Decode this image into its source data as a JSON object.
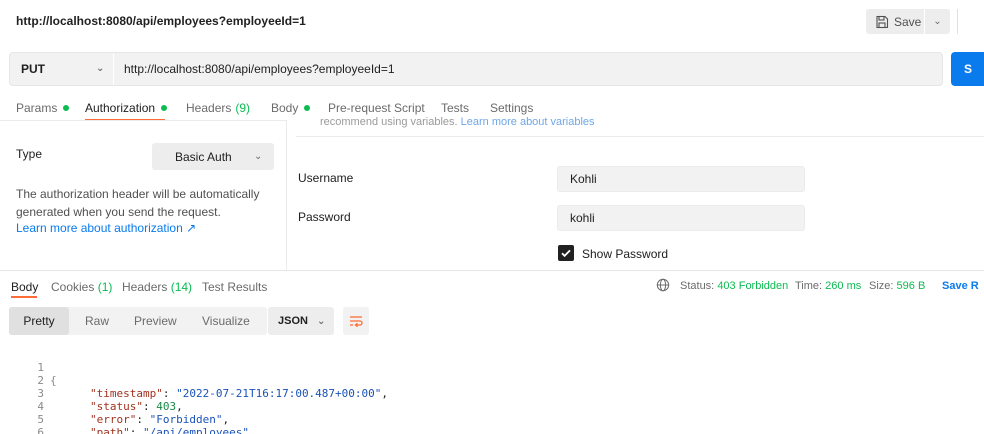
{
  "header": {
    "title": "http://localhost:8080/api/employees?employeeId=1",
    "save_label": "Save"
  },
  "request": {
    "method": "PUT",
    "url": "http://localhost:8080/api/employees?employeeId=1",
    "send_label": "S"
  },
  "request_tabs": [
    {
      "label": "Params",
      "dot": true
    },
    {
      "label": "Authorization",
      "dot": true,
      "active": true
    },
    {
      "label": "Headers",
      "count": "(9)"
    },
    {
      "label": "Body",
      "dot": true
    },
    {
      "label": "Pre-request Script"
    },
    {
      "label": "Tests"
    },
    {
      "label": "Settings"
    }
  ],
  "auth": {
    "type_label": "Type",
    "type_value": "Basic Auth",
    "info_line1": "The authorization header will be automatically",
    "info_line2": "generated when you send the request.",
    "learn_more": "Learn more about authorization ↗",
    "notice_text": "recommend using variables.",
    "notice_link": "Learn more about variables",
    "username_label": "Username",
    "username_value": "Kohli",
    "password_label": "Password",
    "password_value": "kohli",
    "show_password_label": "Show Password",
    "show_password_checked": true
  },
  "response_tabs": [
    {
      "label": "Body",
      "active": true
    },
    {
      "label": "Cookies",
      "count": "(1)"
    },
    {
      "label": "Headers",
      "count": "(14)"
    },
    {
      "label": "Test Results"
    }
  ],
  "response_status": {
    "status_label": "Status:",
    "status_value": "403 Forbidden",
    "time_label": "Time:",
    "time_value": "260 ms",
    "size_label": "Size:",
    "size_value": "596 B",
    "save_response": "Save R"
  },
  "view_modes": [
    "Pretty",
    "Raw",
    "Preview",
    "Visualize"
  ],
  "active_view": "Pretty",
  "format": "JSON",
  "code_lines": [
    {
      "n": "1",
      "text": "{"
    },
    {
      "n": "2",
      "key": "\"timestamp\"",
      "value": "\"2022-07-21T16:17:00.487+00:00\"",
      "type": "str",
      "trail": ","
    },
    {
      "n": "3",
      "key": "\"status\"",
      "value": "403",
      "type": "num",
      "trail": ","
    },
    {
      "n": "4",
      "key": "\"error\"",
      "value": "\"Forbidden\"",
      "type": "str",
      "trail": ","
    },
    {
      "n": "5",
      "key": "\"path\"",
      "value_prefix": "\"",
      "value_link": "/api/employees",
      "value_suffix": "\"",
      "type": "url",
      "trail": ""
    },
    {
      "n": "6",
      "text": "}"
    }
  ],
  "colors": {
    "accent_orange": "#ff6c37",
    "primary_blue": "#097bed",
    "success_green": "#0cbb52"
  }
}
